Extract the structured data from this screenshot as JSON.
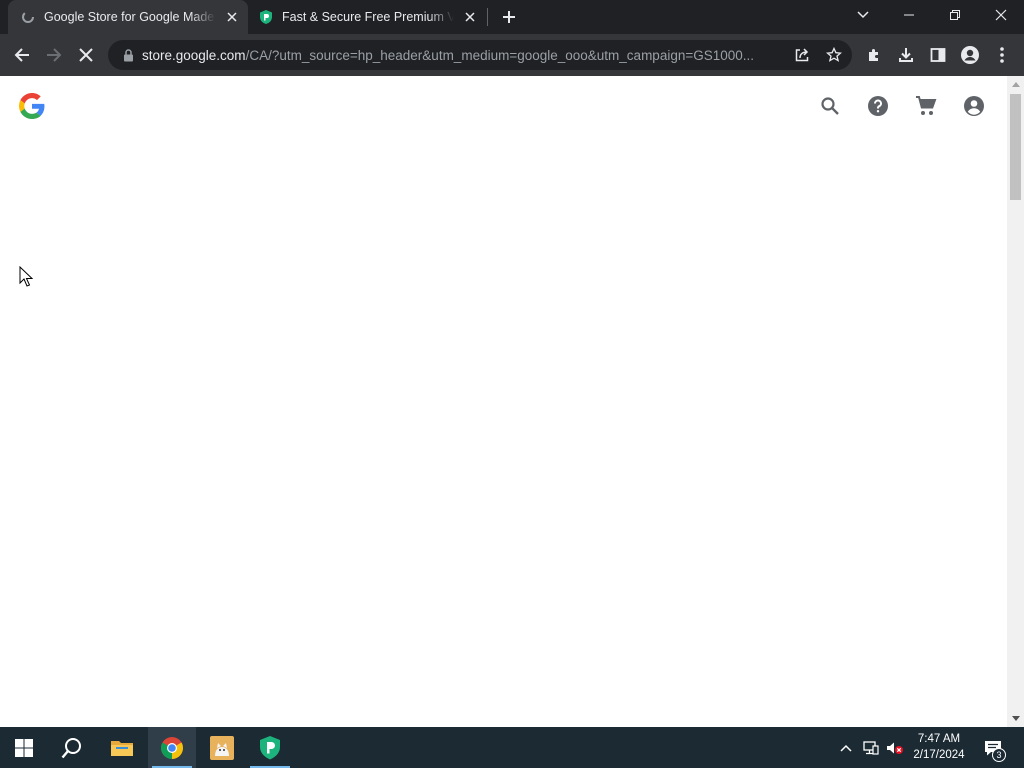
{
  "browser": {
    "tabs": [
      {
        "title": "Google Store for Google Made Devices",
        "active": true,
        "favicon": "loading-spinner-icon"
      },
      {
        "title": "Fast & Secure Free Premium VPN",
        "active": false,
        "favicon": "privadovpn-icon"
      }
    ],
    "url": {
      "host": "store.google.com",
      "path": "/CA/?utm_source=hp_header&utm_medium=google_ooo&utm_campaign=GS1000..."
    }
  },
  "page": {
    "logo": "google-g-logo",
    "header_icons": [
      "search-icon",
      "help-icon",
      "cart-icon",
      "account-icon"
    ]
  },
  "taskbar": {
    "apps": [
      "start",
      "search",
      "file-explorer",
      "chrome",
      "app-cat",
      "privadovpn"
    ],
    "clock": {
      "time": "7:47 AM",
      "date": "2/17/2024"
    },
    "notifications_count": "3"
  },
  "colors": {
    "tab_strip": "#202124",
    "toolbar": "#35363a",
    "page_bg": "#ffffff",
    "taskbar": "#1c2a33",
    "vpn_green": "#1db37d"
  }
}
